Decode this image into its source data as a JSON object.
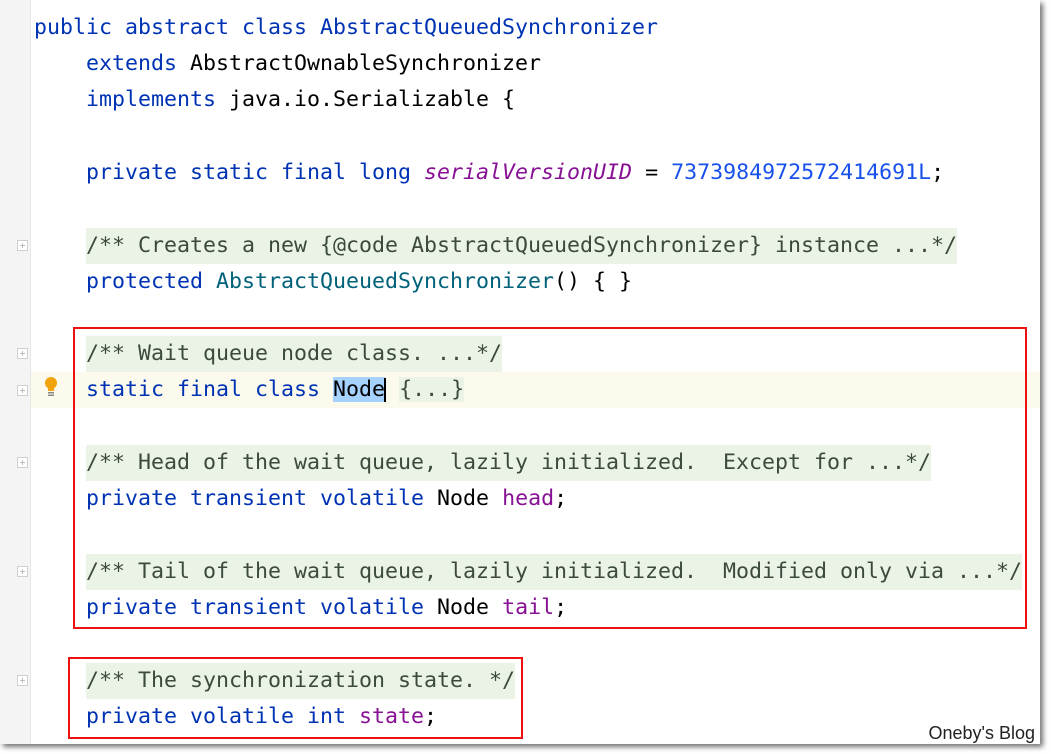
{
  "editor": {
    "lines": [
      {
        "t": [
          "public abstract class AbstractQueuedSynchronizer"
        ]
      },
      {
        "t": [
          "extends",
          "AbstractOwnableSynchronizer"
        ]
      },
      {
        "t": [
          "implements",
          "java.io.Serializable {"
        ]
      },
      {
        "t": [
          "private static final long",
          "serialVersionUID",
          "=",
          "7373984972572414691L",
          ";"
        ]
      },
      {
        "t": [
          "/** Creates a new {@code AbstractQueuedSynchronizer} instance ...*/"
        ]
      },
      {
        "t": [
          "protected",
          "AbstractQueuedSynchronizer",
          "() { }"
        ]
      },
      {
        "t": [
          "/** Wait queue node class. ...*/"
        ]
      },
      {
        "t": [
          "static final class",
          "Node",
          "{...}"
        ]
      },
      {
        "t": [
          "/** Head of the wait queue, lazily initialized.  Except for ...*/"
        ]
      },
      {
        "t": [
          "private transient volatile",
          "Node",
          "head",
          ";"
        ]
      },
      {
        "t": [
          "/** Tail of the wait queue, lazily initialized.  Modified only via ...*/"
        ]
      },
      {
        "t": [
          "private transient volatile",
          "Node",
          "tail",
          ";"
        ]
      },
      {
        "t": [
          "/** The synchronization state. */"
        ]
      },
      {
        "t": [
          "private volatile int",
          "state",
          ";"
        ]
      }
    ]
  },
  "icons": {
    "gutter": [
      "fold-icon",
      "intention-bulb-icon"
    ]
  },
  "colors": {
    "keyword": "#0033b3",
    "field": "#871094",
    "number": "#1750eb",
    "comment_bg": "#eaf3e6",
    "highlight_box": "#ee1111"
  },
  "watermark": "Oneby's Blog"
}
